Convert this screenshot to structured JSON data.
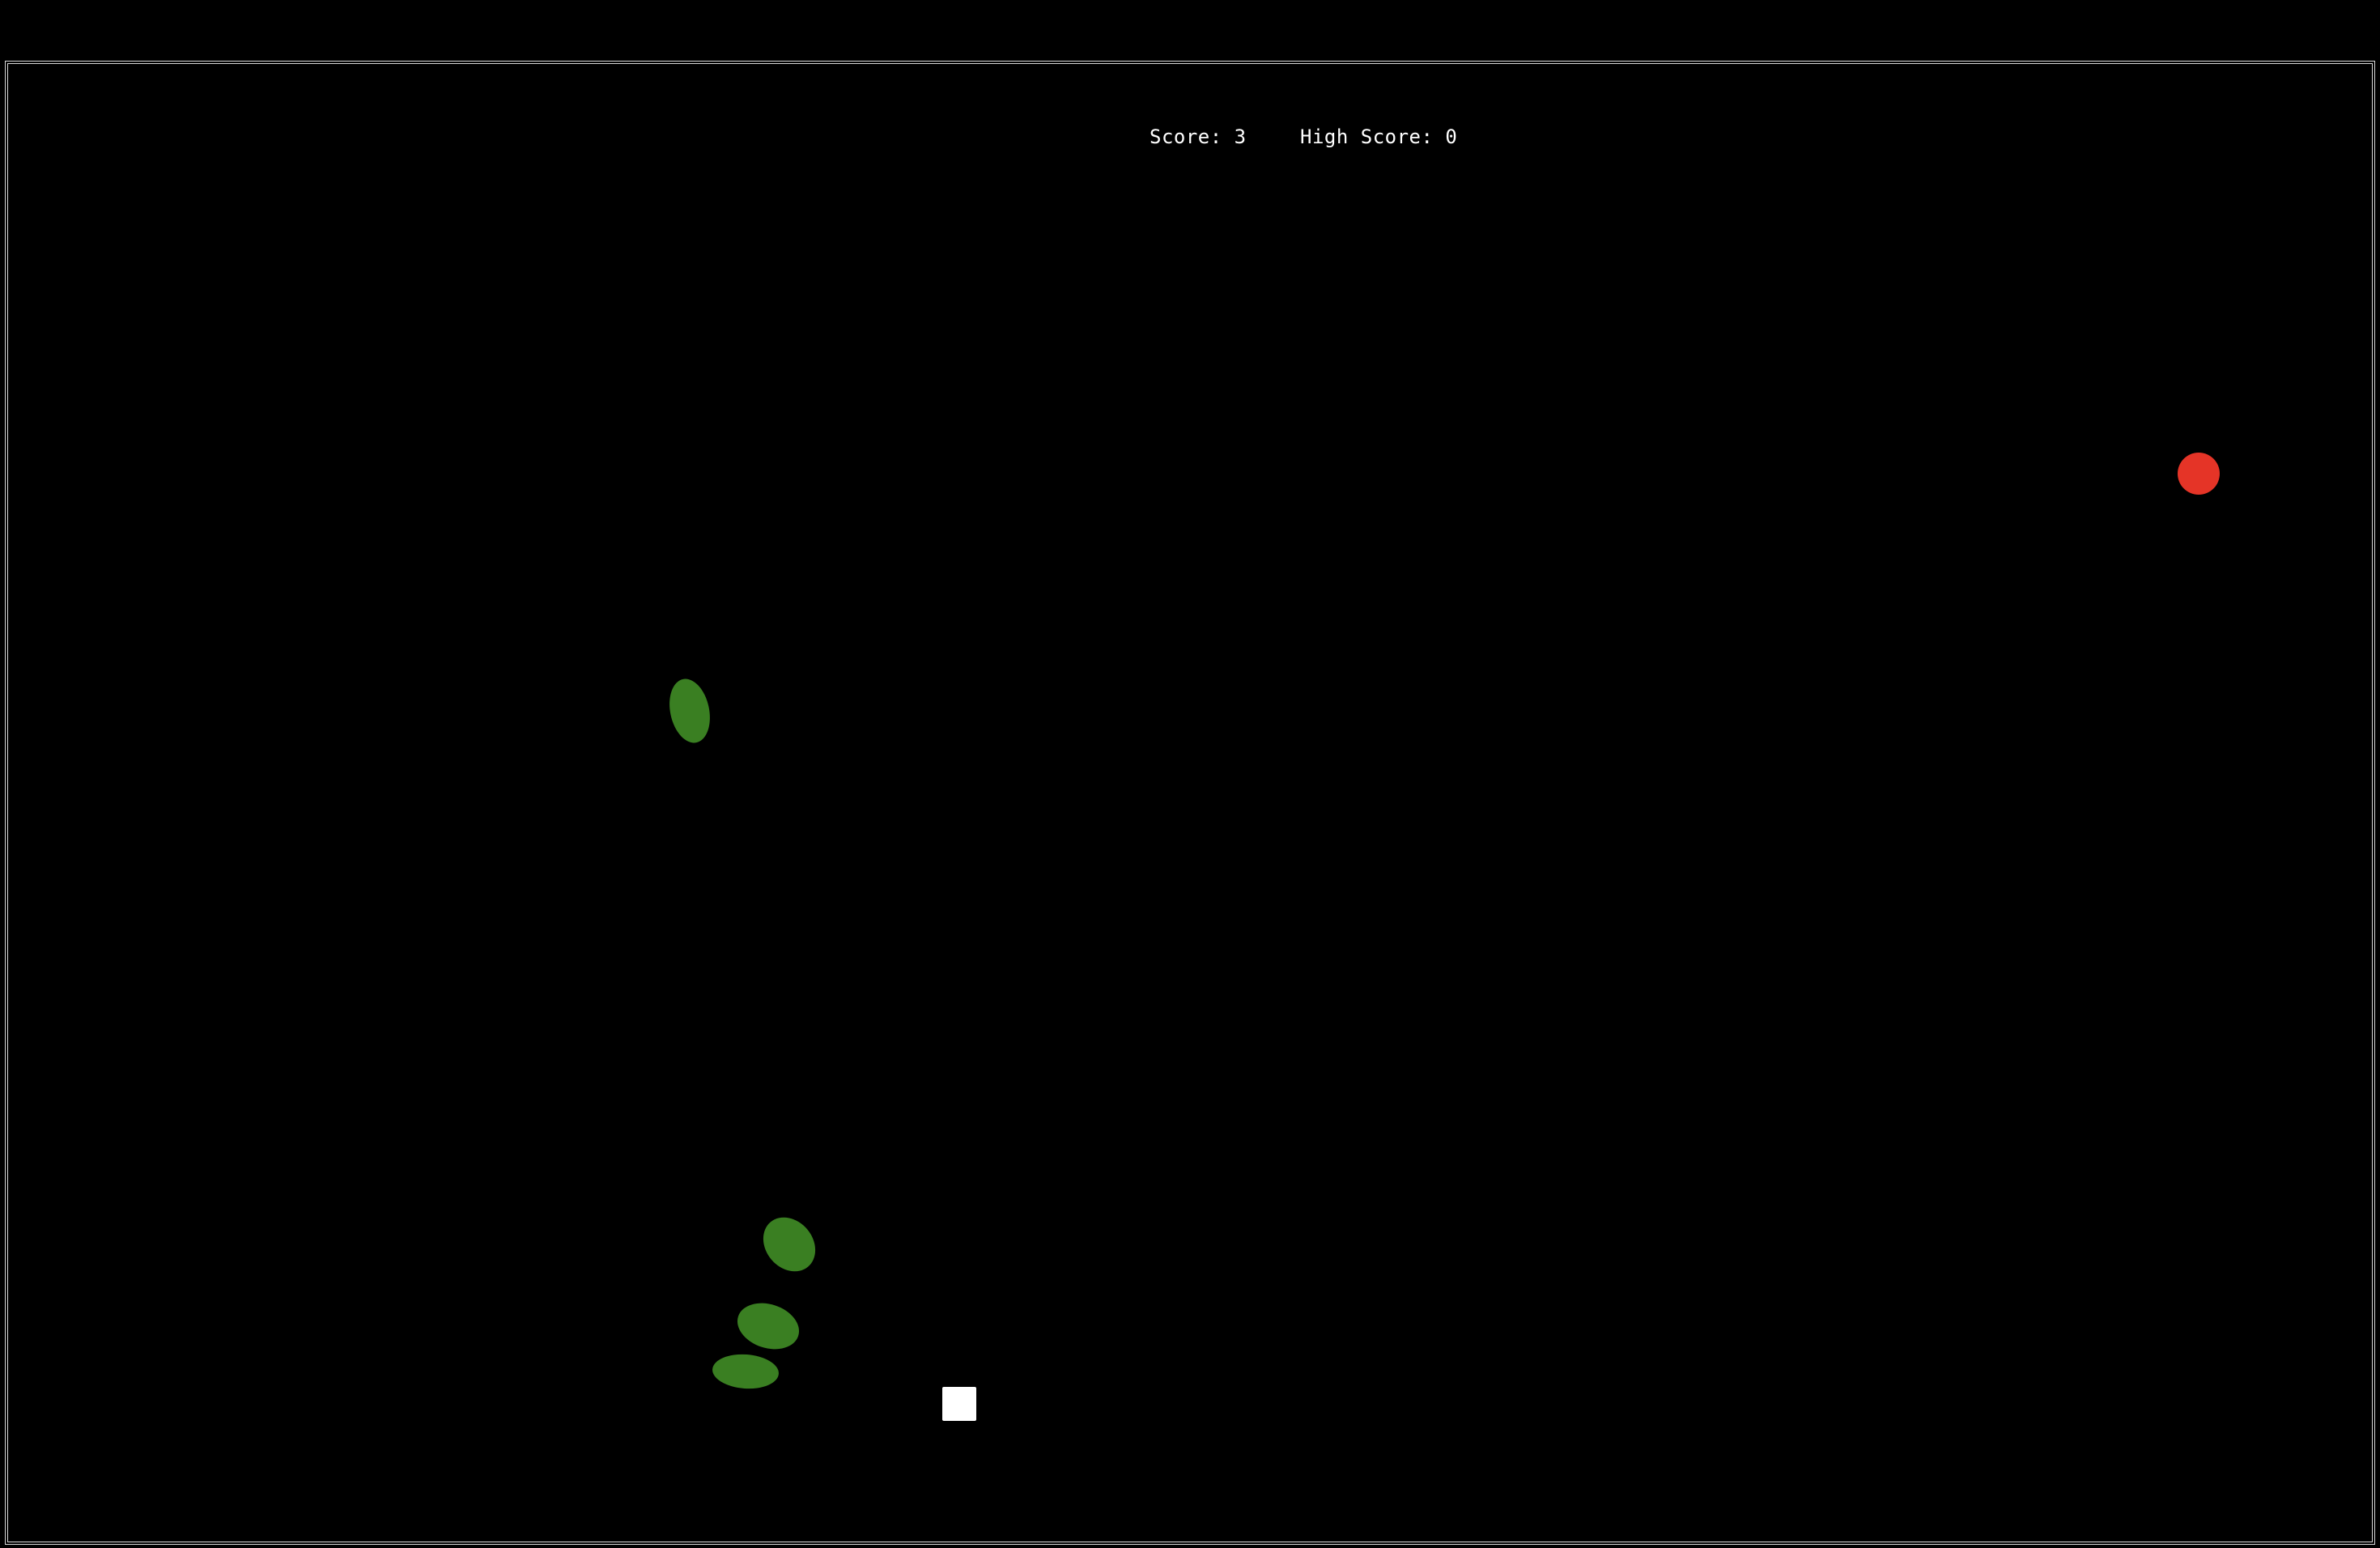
{
  "hud": {
    "score_label": "Score:",
    "score_value": "3",
    "high_score_label": "High Score:",
    "high_score_value": "0"
  },
  "colors": {
    "background": "#000000",
    "border": "#d9d9d9",
    "hud_text": "#ffffff",
    "leaf": "#3a7f22",
    "apple": "#e53427",
    "player": "#ffffff"
  },
  "sprites": [
    {
      "name": "leaf-obstacle-icon",
      "kind": "leaf"
    },
    {
      "name": "leaf-obstacle-icon",
      "kind": "leaf"
    },
    {
      "name": "leaf-obstacle-icon",
      "kind": "leaf"
    },
    {
      "name": "leaf-obstacle-icon",
      "kind": "leaf"
    },
    {
      "name": "apple-food-icon",
      "kind": "apple"
    },
    {
      "name": "player-square-icon",
      "kind": "player"
    }
  ]
}
